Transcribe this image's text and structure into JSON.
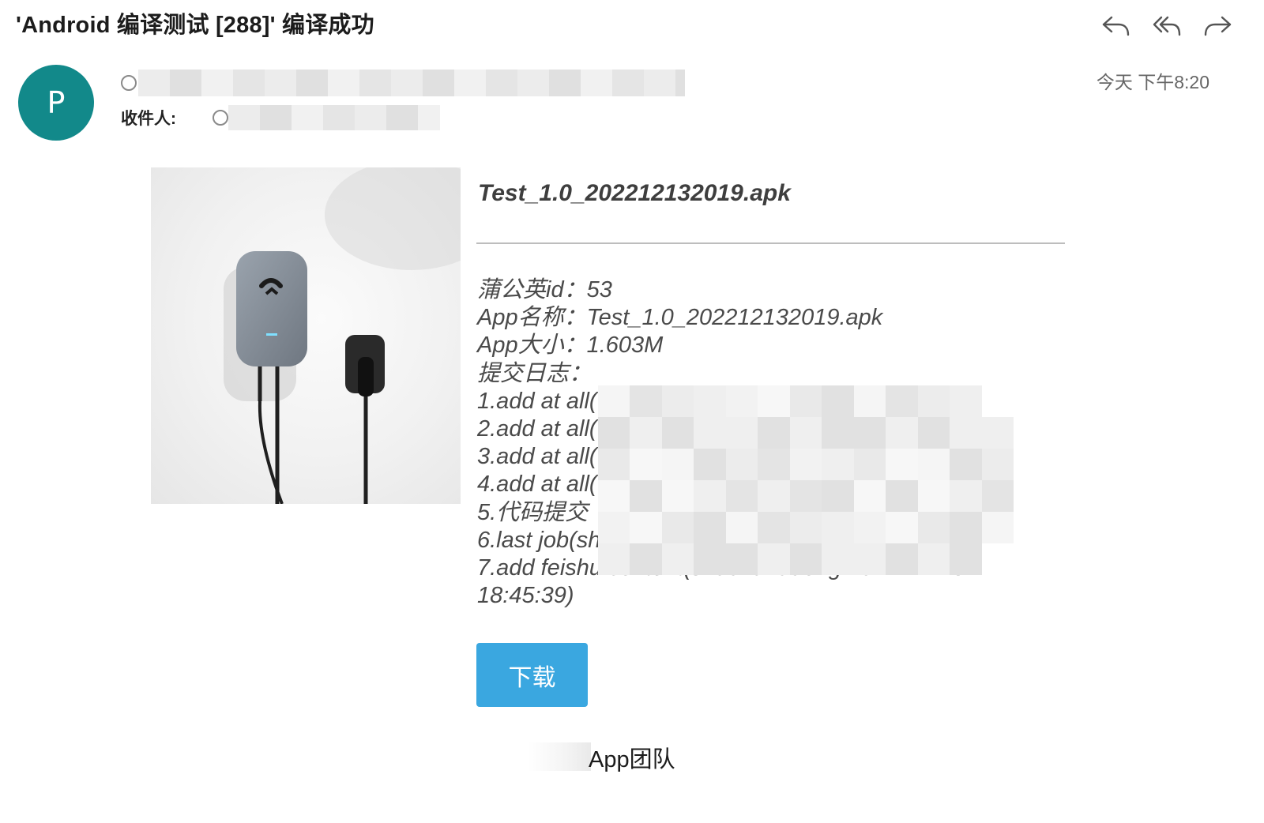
{
  "email": {
    "subject": "'Android 编译测试 [288]' 编译成功",
    "avatar_letter": "P",
    "avatar_color": "#12898a",
    "recipient_label": "收件人:",
    "datetime": "今天 下午8:20"
  },
  "actions": {
    "reply_icon": "reply-icon",
    "reply_all_icon": "reply-all-icon",
    "forward_icon": "forward-icon"
  },
  "content": {
    "apk_title": "Test_1.0_202212132019.apk",
    "info_lines": [
      "蒲公英id：53",
      "App名称：Test_1.0_202212132019.apk",
      "App大小：1.603M",
      "提交日志：",
      "1.add at all(",
      "2.add at all(",
      "3.add at all(",
      "4.add at all(",
      "5.代码提交",
      "6.last job(sh",
      "7.add feishu content(shuchunudong 2022-12-13 18:45:39)"
    ],
    "download_label": "下载",
    "accent_color": "#3aa7e0",
    "signature": "App团队"
  }
}
